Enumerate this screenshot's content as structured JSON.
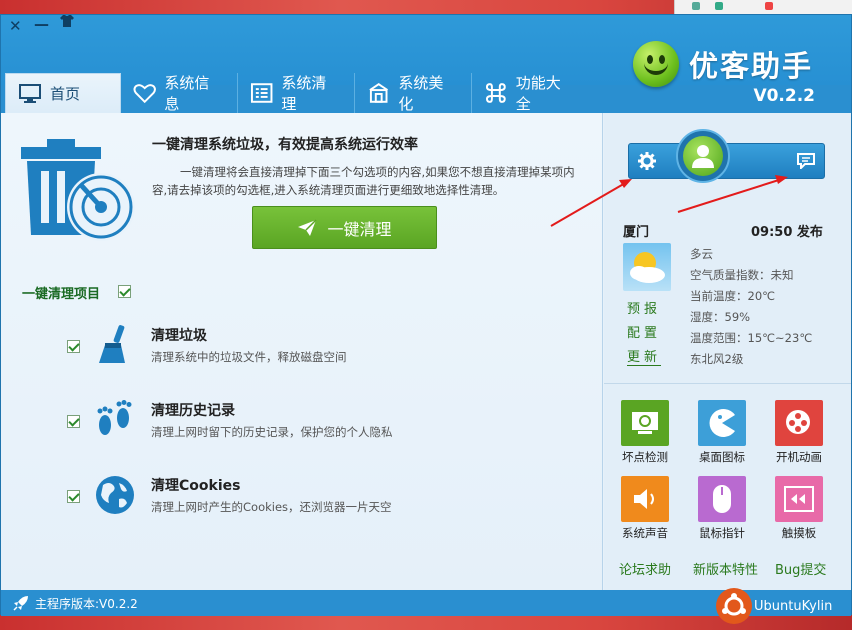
{
  "window": {
    "close": "✕",
    "minimize": "—",
    "menu": "▾"
  },
  "brand": {
    "name": "优客助手",
    "version": "V0.2.2"
  },
  "tabs": [
    {
      "label": "首页"
    },
    {
      "label": "系统信息"
    },
    {
      "label": "系统清理"
    },
    {
      "label": "系统美化"
    },
    {
      "label": "功能大全"
    }
  ],
  "hero": {
    "title": "一键清理系统垃圾，有效提高系统运行效率",
    "desc": "一键清理将会直接清理掉下面三个勾选项的内容,如果您不想直接清理掉某项内容,请去掉该项的勾选框,进入系统清理页面进行更细致地选择性清理。",
    "button": "一键清理"
  },
  "items_section": {
    "title": "一键清理项目",
    "items": [
      {
        "title": "清理垃圾",
        "desc": "清理系统中的垃圾文件，释放磁盘空间"
      },
      {
        "title": "清理历史记录",
        "desc": "清理上网时留下的历史记录，保护您的个人隐私"
      },
      {
        "title": "清理Cookies",
        "desc": "清理上网时产生的Cookies，还浏览器一片天空"
      }
    ]
  },
  "weather": {
    "city": "厦门",
    "time": "09:50 发布",
    "links": [
      "预报",
      "配置",
      "更新"
    ],
    "info": [
      "多云",
      "空气质量指数：未知",
      "当前温度：20℃",
      "湿度：59%",
      "温度范围：15℃~23℃",
      "东北风2级"
    ]
  },
  "tools": [
    {
      "label": "坏点检测",
      "color": "#5aa523"
    },
    {
      "label": "桌面图标",
      "color": "#3d9fd8"
    },
    {
      "label": "开机动画",
      "color": "#e0443e"
    },
    {
      "label": "系统声音",
      "color": "#f08a1c"
    },
    {
      "label": "鼠标指针",
      "color": "#b96ad0"
    },
    {
      "label": "触摸板",
      "color": "#e86aa8"
    }
  ],
  "bottom_links": [
    "论坛求助",
    "新版本特性",
    "Bug提交"
  ],
  "footer": {
    "version": "主程序版本:V0.2.2"
  },
  "desktop": {
    "brand": "UbuntuKylin"
  }
}
